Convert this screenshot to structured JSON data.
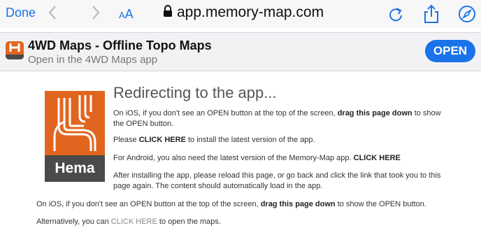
{
  "toolbar": {
    "done_label": "Done",
    "aa_small": "A",
    "aa_big": "A",
    "url": "app.memory-map.com",
    "icons": [
      "back-arrow-icon",
      "forward-arrow-icon",
      "lock-icon",
      "reload-icon",
      "share-icon",
      "compass-icon"
    ]
  },
  "smart_banner": {
    "title": "4WD Maps - Offline Topo Maps",
    "subtitle": "Open in the 4WD Maps app",
    "open_label": "OPEN"
  },
  "logo": {
    "text": "Hema"
  },
  "content": {
    "heading": "Redirecting to the app...",
    "p1": {
      "pre": "On iOS, if you don't see an OPEN button at the top of the screen, ",
      "bold": "drag this page down",
      "post": " to show the OPEN button."
    },
    "p2": {
      "pre": "Please ",
      "link": "CLICK HERE",
      "post": " to install the latest version of the app."
    },
    "p3": {
      "pre": "For Android, you also need the latest version of the Memory-Map app. ",
      "link": "CLICK HERE"
    },
    "p4": "After installing the app, please reload this page, or go back and click the link that took you to this page again. The content should automatically load in the app.",
    "p5": {
      "pre": "On iOS, if you don't see an OPEN button at the top of the screen, ",
      "bold": "drag this page down",
      "post": " to show the OPEN button."
    },
    "p6": {
      "pre": "Alternatively, you can ",
      "link": "CLICK HERE",
      "post": " to open the maps."
    }
  }
}
